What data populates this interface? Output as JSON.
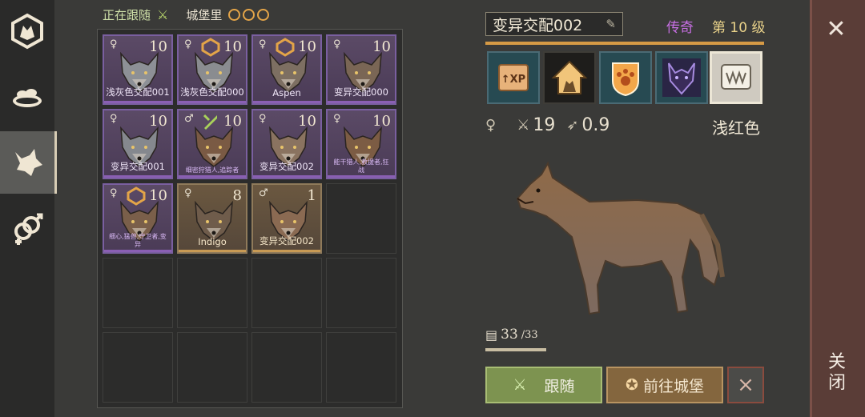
{
  "sidebar": {
    "tabs": [
      {
        "name": "wolf-clan-icon"
      },
      {
        "name": "food-bowl-icon"
      },
      {
        "name": "wolf-head-icon"
      },
      {
        "name": "breeding-icon"
      }
    ]
  },
  "status": {
    "following": "正在跟随",
    "location": "城堡里"
  },
  "pets": [
    {
      "name": "浅灰色交配001",
      "level": "10",
      "gender": "♀",
      "rarity": "purple",
      "fur": "#8d9096"
    },
    {
      "name": "浅灰色交配000",
      "level": "10",
      "gender": "♀",
      "rarity": "purple",
      "fur": "#8a8c90",
      "badge": "castle"
    },
    {
      "name": "Aspen",
      "level": "10",
      "gender": "♀",
      "rarity": "purple",
      "fur": "#7d6f62",
      "badge": "castle"
    },
    {
      "name": "变异交配000",
      "level": "10",
      "gender": "♀",
      "rarity": "purple",
      "fur": "#7a6655"
    },
    {
      "name": "变异交配001",
      "level": "10",
      "gender": "♀",
      "rarity": "purple",
      "fur": "#85888e"
    },
    {
      "name": "细密狩猎人,追踪者",
      "level": "10",
      "gender": "♂",
      "rarity": "purple",
      "fur": "#7a5a44",
      "badge": "follow",
      "small": true
    },
    {
      "name": "变异交配002",
      "level": "10",
      "gender": "♀",
      "rarity": "purple",
      "fur": "#8a7360"
    },
    {
      "name": "能干猎人,救援者,狂战",
      "level": "10",
      "gender": "♀",
      "rarity": "purple",
      "fur": "#7c5c44",
      "small": true
    },
    {
      "name": "细心,猛兽,守卫者,变异",
      "level": "10",
      "gender": "♀",
      "rarity": "purple",
      "fur": "#7a5f4a",
      "badge": "castle",
      "small": true
    },
    {
      "name": "Indigo",
      "level": "8",
      "gender": "♀",
      "rarity": "gold",
      "fur": "#6f5c4b"
    },
    {
      "name": "变异交配002",
      "level": "1",
      "gender": "♂",
      "rarity": "gold",
      "fur": "#8a6a52"
    }
  ],
  "detail": {
    "name": "变异交配002",
    "rarity_label": "传奇",
    "level_label": "第 10 级",
    "attack": "19",
    "speed": "0.9",
    "color_name": "浅红色",
    "hunger_current": "33",
    "hunger_max": "/33",
    "hunger_fraction": 1.0,
    "skills": [
      "xp-boost-icon",
      "castle-wolf-icon",
      "paw-shield-icon",
      "dark-wolf-icon",
      "fang-scroll-icon"
    ]
  },
  "buttons": {
    "follow": "跟随",
    "go_castle": "前往城堡",
    "cancel": "×"
  },
  "close": {
    "x": "✕",
    "label": "关闭"
  },
  "colors": {
    "accent": "#d69a45",
    "legendary": "#c86fe4",
    "follow_green": "#7d9350",
    "castle_orange": "#84663e",
    "panel_red": "#5a3d37"
  }
}
